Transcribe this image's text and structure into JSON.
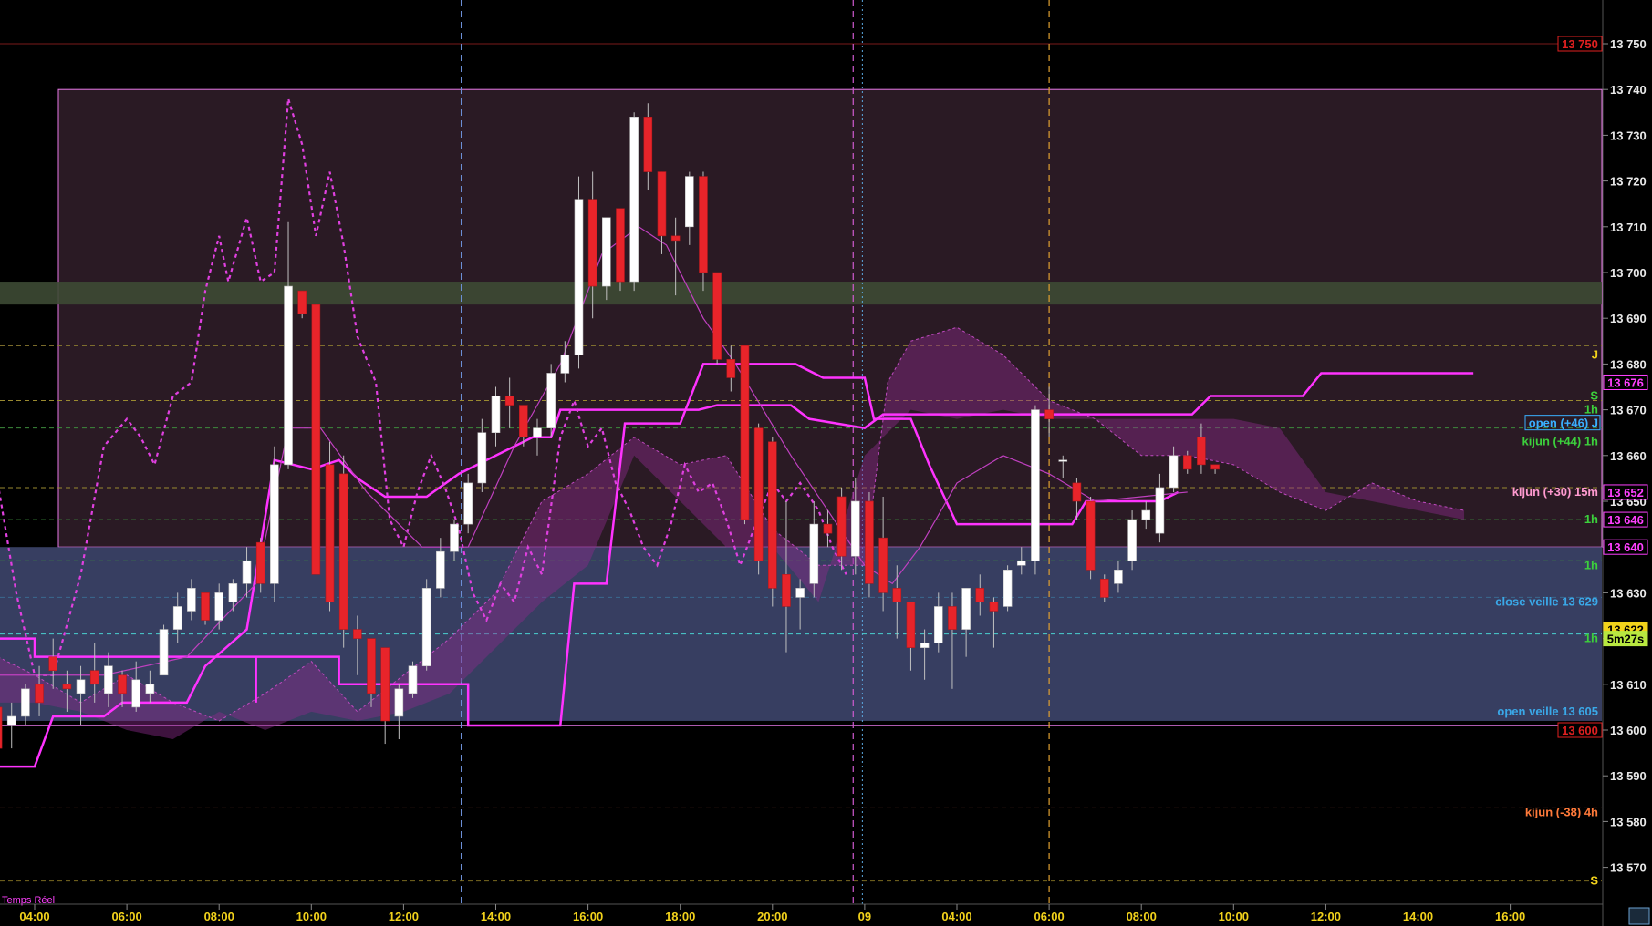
{
  "status_text": "Temps Réel",
  "chart_data": {
    "type": "candlestick",
    "y_range": [
      13563,
      13767
    ],
    "x_range": [
      3.2,
      16.0
    ],
    "y_ticks": [
      13570,
      13580,
      13590,
      13600,
      13610,
      13620,
      13630,
      13640,
      13650,
      13660,
      13670,
      13680,
      13690,
      13700,
      13710,
      13720,
      13730,
      13740,
      13750
    ],
    "y_tick_labels": [
      "13 570",
      "13 580",
      "13 590",
      "13 600",
      "13 610",
      "13 620",
      "13 630",
      "13 640",
      "13 650",
      "13 660",
      "13 670",
      "13 680",
      "13 690",
      "13 700",
      "13 710",
      "13 720",
      "13 730",
      "13 740",
      "13 750"
    ],
    "x_ticks": [
      {
        "t": 4,
        "label": "04:00"
      },
      {
        "t": 6,
        "label": "06:00"
      },
      {
        "t": 8,
        "label": "08:00"
      },
      {
        "t": 10,
        "label": "10:00"
      },
      {
        "t": 12,
        "label": "12:00"
      },
      {
        "t": 14,
        "label": "14:00"
      },
      {
        "t": 16,
        "label": "16:00"
      },
      {
        "t": 18,
        "label": "18:00"
      },
      {
        "t": 20,
        "label": "20:00"
      },
      {
        "t": 22,
        "label": "09"
      },
      {
        "t": 24,
        "label": "04:00"
      },
      {
        "t": 26,
        "label": "06:00"
      },
      {
        "t": 28,
        "label": "08:00"
      },
      {
        "t": 30,
        "label": "10:00"
      },
      {
        "t": 32,
        "label": "12:00"
      },
      {
        "t": 34,
        "label": "14:00"
      },
      {
        "t": 36,
        "label": "16:00"
      }
    ],
    "candles": [
      {
        "t": 3.2,
        "o": 13605,
        "h": 13612,
        "l": 13592,
        "c": 13596
      },
      {
        "t": 3.5,
        "o": 13601,
        "h": 13606,
        "l": 13596,
        "c": 13603
      },
      {
        "t": 3.8,
        "o": 13603,
        "h": 13610,
        "l": 13601,
        "c": 13609
      },
      {
        "t": 4.1,
        "o": 13610,
        "h": 13614,
        "l": 13603,
        "c": 13606
      },
      {
        "t": 4.4,
        "o": 13616,
        "h": 13620,
        "l": 13609,
        "c": 13613
      },
      {
        "t": 4.7,
        "o": 13610,
        "h": 13613,
        "l": 13604,
        "c": 13609
      },
      {
        "t": 5.0,
        "o": 13608,
        "h": 13614,
        "l": 13601,
        "c": 13611
      },
      {
        "t": 5.3,
        "o": 13613,
        "h": 13619,
        "l": 13606,
        "c": 13610
      },
      {
        "t": 5.6,
        "o": 13608,
        "h": 13617,
        "l": 13605,
        "c": 13614
      },
      {
        "t": 5.9,
        "o": 13612,
        "h": 13613,
        "l": 13605,
        "c": 13608
      },
      {
        "t": 6.2,
        "o": 13605,
        "h": 13615,
        "l": 13604,
        "c": 13611
      },
      {
        "t": 6.5,
        "o": 13608,
        "h": 13613,
        "l": 13606,
        "c": 13610
      },
      {
        "t": 6.8,
        "o": 13612,
        "h": 13623,
        "l": 13612,
        "c": 13622
      },
      {
        "t": 7.1,
        "o": 13622,
        "h": 13630,
        "l": 13619,
        "c": 13627
      },
      {
        "t": 7.4,
        "o": 13626,
        "h": 13633,
        "l": 13624,
        "c": 13631
      },
      {
        "t": 7.7,
        "o": 13630,
        "h": 13629,
        "l": 13623,
        "c": 13624
      },
      {
        "t": 8.0,
        "o": 13624,
        "h": 13632,
        "l": 13622,
        "c": 13630
      },
      {
        "t": 8.3,
        "o": 13628,
        "h": 13633,
        "l": 13626,
        "c": 13632
      },
      {
        "t": 8.6,
        "o": 13632,
        "h": 13640,
        "l": 13629,
        "c": 13637
      },
      {
        "t": 8.9,
        "o": 13641,
        "h": 13642,
        "l": 13630,
        "c": 13632
      },
      {
        "t": 9.2,
        "o": 13632,
        "h": 13662,
        "l": 13628,
        "c": 13658
      },
      {
        "t": 9.5,
        "o": 13658,
        "h": 13711,
        "l": 13657,
        "c": 13697
      },
      {
        "t": 9.8,
        "o": 13696,
        "h": 13694,
        "l": 13690,
        "c": 13691
      },
      {
        "t": 10.1,
        "o": 13693,
        "h": 13690,
        "l": 13634,
        "c": 13634
      },
      {
        "t": 10.4,
        "o": 13658,
        "h": 13663,
        "l": 13626,
        "c": 13628
      },
      {
        "t": 10.7,
        "o": 13656,
        "h": 13660,
        "l": 13618,
        "c": 13622
      },
      {
        "t": 11.0,
        "o": 13622,
        "h": 13625,
        "l": 13612,
        "c": 13620
      },
      {
        "t": 11.3,
        "o": 13620,
        "h": 13619,
        "l": 13605,
        "c": 13608
      },
      {
        "t": 11.6,
        "o": 13618,
        "h": 13613,
        "l": 13597,
        "c": 13602
      },
      {
        "t": 11.9,
        "o": 13603,
        "h": 13610,
        "l": 13598,
        "c": 13609
      },
      {
        "t": 12.2,
        "o": 13608,
        "h": 13615,
        "l": 13607,
        "c": 13614
      },
      {
        "t": 12.5,
        "o": 13614,
        "h": 13633,
        "l": 13613,
        "c": 13631
      },
      {
        "t": 12.8,
        "o": 13631,
        "h": 13642,
        "l": 13629,
        "c": 13639
      },
      {
        "t": 13.1,
        "o": 13639,
        "h": 13646,
        "l": 13637,
        "c": 13645
      },
      {
        "t": 13.4,
        "o": 13645,
        "h": 13656,
        "l": 13643,
        "c": 13654
      },
      {
        "t": 13.7,
        "o": 13654,
        "h": 13668,
        "l": 13652,
        "c": 13665
      },
      {
        "t": 14.0,
        "o": 13665,
        "h": 13675,
        "l": 13662,
        "c": 13673
      },
      {
        "t": 14.3,
        "o": 13673,
        "h": 13677,
        "l": 13666,
        "c": 13671
      },
      {
        "t": 14.6,
        "o": 13671,
        "h": 13670,
        "l": 13662,
        "c": 13664
      },
      {
        "t": 14.9,
        "o": 13664,
        "h": 13668,
        "l": 13660,
        "c": 13666
      },
      {
        "t": 15.2,
        "o": 13666,
        "h": 13680,
        "l": 13664,
        "c": 13678
      },
      {
        "t": 15.5,
        "o": 13678,
        "h": 13685,
        "l": 13676,
        "c": 13682
      },
      {
        "t": 15.8,
        "o": 13682,
        "h": 13721,
        "l": 13679,
        "c": 13716
      },
      {
        "t": 16.1,
        "o": 13716,
        "h": 13722,
        "l": 13690,
        "c": 13697
      },
      {
        "t": 16.4,
        "o": 13697,
        "h": 13712,
        "l": 13694,
        "c": 13712
      },
      {
        "t": 16.7,
        "o": 13714,
        "h": 13712,
        "l": 13696,
        "c": 13698
      },
      {
        "t": 17.0,
        "o": 13698,
        "h": 13735,
        "l": 13696,
        "c": 13734
      },
      {
        "t": 17.3,
        "o": 13734,
        "h": 13737,
        "l": 13718,
        "c": 13722
      },
      {
        "t": 17.6,
        "o": 13722,
        "h": 13720,
        "l": 13704,
        "c": 13708
      },
      {
        "t": 17.9,
        "o": 13708,
        "h": 13712,
        "l": 13695,
        "c": 13707
      },
      {
        "t": 18.2,
        "o": 13710,
        "h": 13722,
        "l": 13706,
        "c": 13721
      },
      {
        "t": 18.5,
        "o": 13721,
        "h": 13722,
        "l": 13696,
        "c": 13700
      },
      {
        "t": 18.8,
        "o": 13700,
        "h": 13700,
        "l": 13680,
        "c": 13681
      },
      {
        "t": 19.1,
        "o": 13681,
        "h": 13684,
        "l": 13674,
        "c": 13677
      },
      {
        "t": 19.4,
        "o": 13684,
        "h": 13683,
        "l": 13645,
        "c": 13646
      },
      {
        "t": 19.7,
        "o": 13666,
        "h": 13667,
        "l": 13634,
        "c": 13637
      },
      {
        "t": 20.0,
        "o": 13663,
        "h": 13664,
        "l": 13627,
        "c": 13631
      },
      {
        "t": 20.3,
        "o": 13634,
        "h": 13650,
        "l": 13617,
        "c": 13627
      },
      {
        "t": 20.6,
        "o": 13629,
        "h": 13633,
        "l": 13622,
        "c": 13631
      },
      {
        "t": 20.9,
        "o": 13632,
        "h": 13650,
        "l": 13629,
        "c": 13645
      },
      {
        "t": 21.2,
        "o": 13645,
        "h": 13648,
        "l": 13640,
        "c": 13643
      },
      {
        "t": 21.5,
        "o": 13651,
        "h": 13653,
        "l": 13635,
        "c": 13638
      },
      {
        "t": 21.8,
        "o": 13638,
        "h": 13655,
        "l": 13634,
        "c": 13650
      },
      {
        "t": 22.1,
        "o": 13650,
        "h": 13652,
        "l": 13629,
        "c": 13632
      },
      {
        "t": 22.4,
        "o": 13642,
        "h": 13651,
        "l": 13626,
        "c": 13630
      }
    ],
    "candles2": [
      {
        "t": 22.7,
        "o": 13631,
        "h": 13636,
        "l": 13620,
        "c": 13628
      },
      {
        "t": 23.0,
        "o": 13628,
        "h": 13626,
        "l": 13613,
        "c": 13618
      },
      {
        "t": 23.3,
        "o": 13618,
        "h": 13622,
        "l": 13611,
        "c": 13619
      },
      {
        "t": 23.6,
        "o": 13619,
        "h": 13630,
        "l": 13617,
        "c": 13627
      },
      {
        "t": 23.9,
        "o": 13627,
        "h": 13630,
        "l": 13609,
        "c": 13622
      },
      {
        "t": 24.2,
        "o": 13622,
        "h": 13628,
        "l": 13616,
        "c": 13631
      },
      {
        "t": 24.5,
        "o": 13631,
        "h": 13634,
        "l": 13625,
        "c": 13628
      },
      {
        "t": 24.8,
        "o": 13628,
        "h": 13629,
        "l": 13618,
        "c": 13626
      },
      {
        "t": 25.1,
        "o": 13627,
        "h": 13636,
        "l": 13626,
        "c": 13635
      },
      {
        "t": 25.4,
        "o": 13636,
        "h": 13640,
        "l": 13634,
        "c": 13637
      },
      {
        "t": 25.7,
        "o": 13637,
        "h": 13671,
        "l": 13634,
        "c": 13670
      },
      {
        "t": 26.0,
        "o": 13670,
        "h": 13675,
        "l": 13664,
        "c": 13668
      },
      {
        "t": 26.3,
        "o": 13659,
        "h": 13660,
        "l": 13655,
        "c": 13659
      },
      {
        "t": 26.6,
        "o": 13654,
        "h": 13655,
        "l": 13646,
        "c": 13650
      },
      {
        "t": 26.9,
        "o": 13650,
        "h": 13651,
        "l": 13633,
        "c": 13635
      },
      {
        "t": 27.2,
        "o": 13633,
        "h": 13634,
        "l": 13628,
        "c": 13629
      },
      {
        "t": 27.5,
        "o": 13632,
        "h": 13637,
        "l": 13630,
        "c": 13635
      },
      {
        "t": 27.8,
        "o": 13637,
        "h": 13648,
        "l": 13635,
        "c": 13646
      },
      {
        "t": 28.1,
        "o": 13646,
        "h": 13650,
        "l": 13644,
        "c": 13648
      },
      {
        "t": 28.4,
        "o": 13643,
        "h": 13656,
        "l": 13641,
        "c": 13653
      },
      {
        "t": 28.7,
        "o": 13653,
        "h": 13662,
        "l": 13652,
        "c": 13660
      },
      {
        "t": 29.0,
        "o": 13660,
        "h": 13661,
        "l": 13656,
        "c": 13657
      },
      {
        "t": 29.3,
        "o": 13664,
        "h": 13667,
        "l": 13656,
        "c": 13658
      },
      {
        "t": 29.6,
        "o": 13658,
        "h": 13657,
        "l": 13656,
        "c": 13657
      }
    ]
  },
  "ui": {
    "gridColor": "#1a1a1a",
    "bullColor": "#ffffff",
    "bearColor": "#e8242a",
    "wickColor": "#c0c0c0",
    "lineMagenta": "#ff33ff",
    "cloudColor": "#8a2a8a",
    "blueZone": "#3a4166",
    "upperZone": "#2a1a24",
    "greenBand": "#3d4a34"
  }
}
